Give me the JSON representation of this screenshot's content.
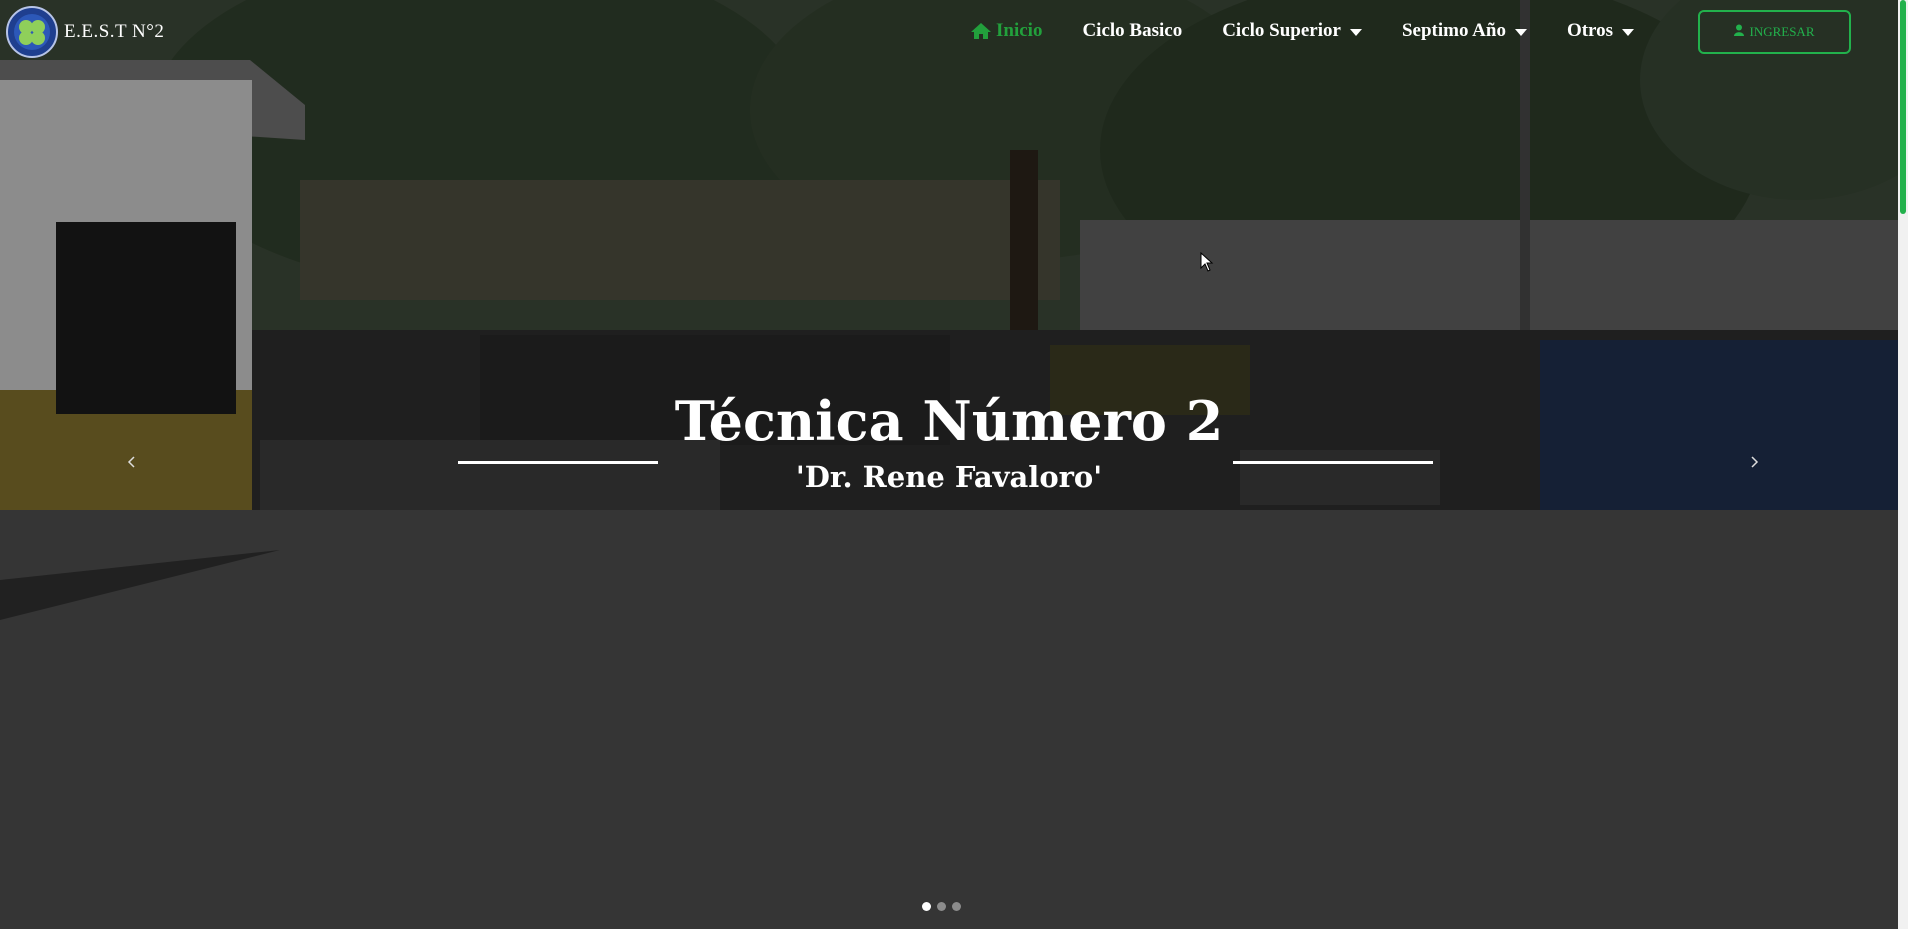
{
  "brand": {
    "name": "E.E.S.T N°2",
    "logo_icon": "school-emblem-icon"
  },
  "nav": {
    "items": [
      {
        "label": "Inicio",
        "icon": "home-icon",
        "active": true
      },
      {
        "label": "Ciclo Basico",
        "dropdown": false
      },
      {
        "label": "Ciclo Superior",
        "dropdown": true
      },
      {
        "label": "Septimo Año",
        "dropdown": true
      },
      {
        "label": "Otros",
        "dropdown": true
      }
    ],
    "login_label": "INGRESAR",
    "login_icon": "user-icon"
  },
  "carousel": {
    "title": "Técnica Número 2",
    "subtitle": "'Dr. Rene Favaloro'",
    "prev_icon": "chevron-left-icon",
    "next_icon": "chevron-right-icon",
    "slide_count": 3,
    "active_slide": 1
  },
  "colors": {
    "accent": "#22b14c",
    "active_nav": "#22a03c",
    "text": "#ffffff"
  }
}
